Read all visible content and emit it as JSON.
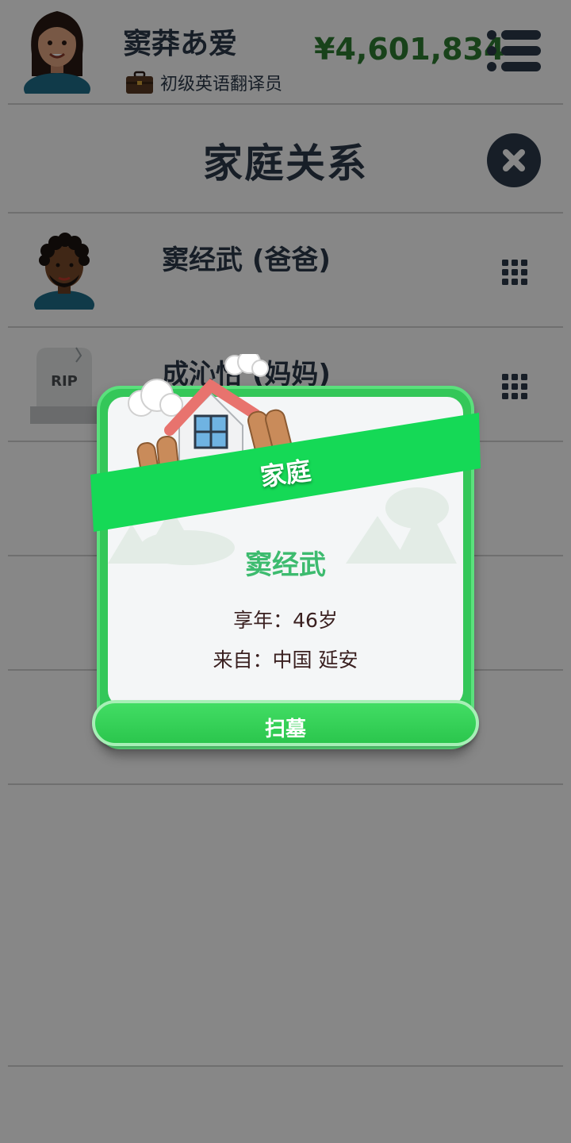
{
  "header": {
    "player_name": "窦莽あ爱",
    "job_title": "初级英语翻译员",
    "money": "¥4,601,834"
  },
  "page": {
    "title": "家庭关系"
  },
  "relatives": [
    {
      "name": "窦经武 (爸爸)",
      "status": "alive"
    },
    {
      "name": "成沁怡 (妈妈)",
      "status": "deceased",
      "tombstone_text": "RIP"
    }
  ],
  "dialog": {
    "banner": "家庭",
    "name": "窦经武",
    "age_line": "享年：46岁",
    "origin_line": "来自：中国 延安",
    "button_label": "扫墓"
  },
  "colors": {
    "accent_green": "#34c759",
    "money_green": "#2e7d32",
    "name_green": "#3dbb6f",
    "dark_navy": "#2c3a4a",
    "overlay": "rgba(0,0,0,0.47)"
  }
}
